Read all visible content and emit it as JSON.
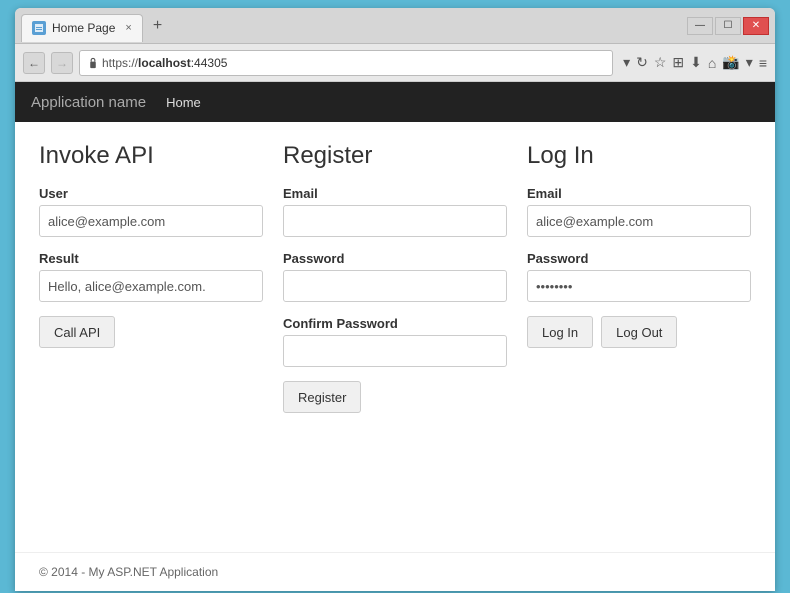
{
  "browser": {
    "tab_title": "Home Page",
    "tab_close": "×",
    "new_tab": "+",
    "url": "https://localhost:44305",
    "url_parts": {
      "scheme": "https://",
      "host": "localhost",
      "port": ":44305"
    },
    "window_controls": {
      "minimize": "—",
      "maximize": "☐",
      "close": "✕"
    }
  },
  "navbar": {
    "brand": "Application name",
    "links": [
      "Home"
    ]
  },
  "invoke_api": {
    "title": "Invoke API",
    "user_label": "User",
    "user_value": "alice@example.com",
    "result_label": "Result",
    "result_value": "Hello, alice@example.com.",
    "call_button": "Call API"
  },
  "register": {
    "title": "Register",
    "email_label": "Email",
    "email_value": "",
    "email_placeholder": "",
    "password_label": "Password",
    "password_value": "",
    "confirm_label": "Confirm Password",
    "confirm_value": "",
    "register_button": "Register"
  },
  "login": {
    "title": "Log In",
    "email_label": "Email",
    "email_value": "alice@example.com",
    "password_label": "Password",
    "password_value": "••••••••",
    "login_button": "Log In",
    "logout_button": "Log Out"
  },
  "footer": {
    "text": "© 2014 - My ASP.NET Application"
  }
}
